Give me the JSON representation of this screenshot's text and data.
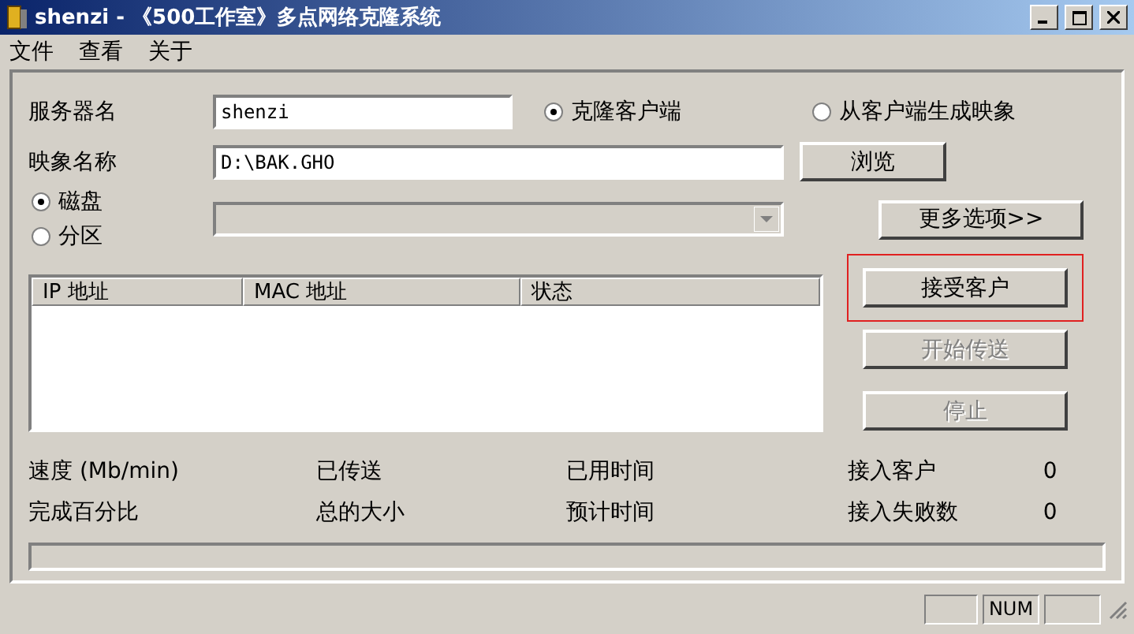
{
  "window": {
    "title": "shenzi - 《500工作室》多点网络克隆系统"
  },
  "menu": [
    "文件",
    "查看",
    "关于"
  ],
  "server_name": {
    "label": "服务器名",
    "value": "shenzi"
  },
  "mode_options": [
    {
      "label": "克隆客户端",
      "selected": true
    },
    {
      "label": "从客户端生成映象",
      "selected": false
    }
  ],
  "image_name": {
    "label": "映象名称",
    "value": "D:\\BAK.GHO"
  },
  "browse_button": "浏览",
  "source_options": [
    {
      "label": "磁盘",
      "selected": true
    },
    {
      "label": "分区",
      "selected": false
    }
  ],
  "partition_select": {
    "disabled": true
  },
  "more_options_button": "更多选项>>",
  "client_table": {
    "columns": [
      "IP 地址",
      "MAC 地址",
      "状态"
    ]
  },
  "action_buttons": [
    {
      "label": "接受客户",
      "disabled": false,
      "highlighted": true
    },
    {
      "label": "开始传送",
      "disabled": true,
      "highlighted": false
    },
    {
      "label": "停止",
      "disabled": true,
      "highlighted": false
    }
  ],
  "progress": {
    "level": 0
  },
  "stats": [
    {
      "cells": [
        "速度 (Mb/min)",
        "已传送",
        "已用时间",
        "接入客户",
        "0"
      ]
    },
    {
      "cells": [
        "完成百分比",
        "总的大小",
        "预计时间",
        "接入失败数",
        "0"
      ]
    }
  ],
  "status_bar": {
    "num_indicator": "NUM"
  }
}
